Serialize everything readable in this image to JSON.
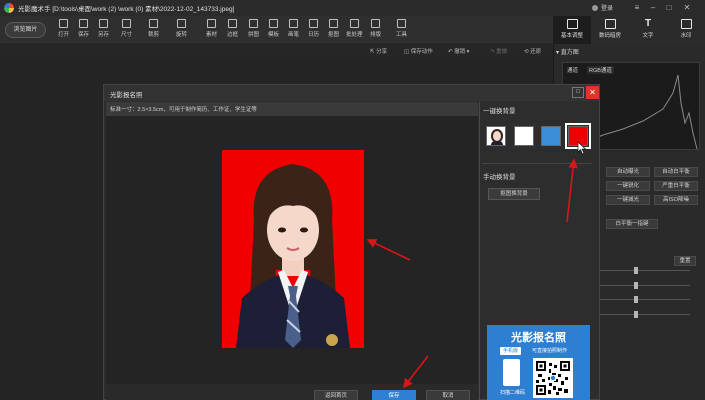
{
  "window": {
    "app_title": "光影魔术手",
    "file_path": "[D:\\tools\\桌面\\work (2) \\work (0) 素材\\2022-12-02_143733.jpeg]",
    "login_label": "登录"
  },
  "toolbar": {
    "browse_label": "浏览图片",
    "items": [
      {
        "label": "打开",
        "icon": "folder-open-icon"
      },
      {
        "label": "保存",
        "icon": "save-icon"
      },
      {
        "label": "另存",
        "icon": "save-as-icon"
      },
      {
        "label": "尺寸",
        "icon": "resize-icon"
      },
      {
        "label": "裁剪",
        "icon": "crop-icon"
      },
      {
        "label": "旋转",
        "icon": "rotate-icon"
      },
      {
        "label": "素材",
        "icon": "material-icon"
      },
      {
        "label": "边框",
        "icon": "border-icon"
      },
      {
        "label": "拼图",
        "icon": "collage-icon"
      },
      {
        "label": "模板",
        "icon": "template-icon"
      },
      {
        "label": "画笔",
        "icon": "brush-icon"
      },
      {
        "label": "日历",
        "icon": "calendar-icon"
      },
      {
        "label": "抠图",
        "icon": "cutout-icon"
      },
      {
        "label": "批处理",
        "icon": "batch-icon"
      },
      {
        "label": "排版",
        "icon": "layout-icon"
      },
      {
        "label": "工具",
        "icon": "tools-icon"
      }
    ]
  },
  "right_tabs": [
    {
      "label": "基本调整",
      "active": true
    },
    {
      "label": "数码暗房",
      "active": false
    },
    {
      "label": "文字",
      "active": false
    },
    {
      "label": "水印",
      "active": false
    }
  ],
  "subbar": {
    "share": "分享",
    "save_action": "保存动作",
    "undo": "撤销",
    "redo": "重做",
    "restore": "还原"
  },
  "right_panel": {
    "histogram_title": "直方图",
    "channel": "通道",
    "channel_value": "RGB通道",
    "buttons": [
      "自动曝光",
      "自动白平衡",
      "一键锐化",
      "严重白平衡",
      "一键减光",
      "高ISO降噪",
      "白平衡一指键"
    ],
    "reset_label": "重置"
  },
  "dialog": {
    "title": "光影报名照",
    "spec": "标准一寸：2.5×3.5cm，可用于制作简历、工作证、学生证等",
    "one_click_title": "一键换背景",
    "manual_title": "手动换背景",
    "manual_button": "抠图换背景",
    "swatches": [
      {
        "name": "portrait",
        "color": "#ffffff"
      },
      {
        "name": "white",
        "color": "#ffffff"
      },
      {
        "name": "blue",
        "color": "#3b8fd9"
      },
      {
        "name": "red",
        "color": "#f00000",
        "selected": true
      }
    ],
    "photo_background": "#f00000",
    "footer": {
      "back": "返回首页",
      "save": "保存",
      "cancel": "取消"
    },
    "ad": {
      "title": "光影报名照",
      "tag": "手机版",
      "sub": "可直接拍照制作",
      "scan": "扫描二维码"
    }
  },
  "annotation_color": "#d8161a"
}
